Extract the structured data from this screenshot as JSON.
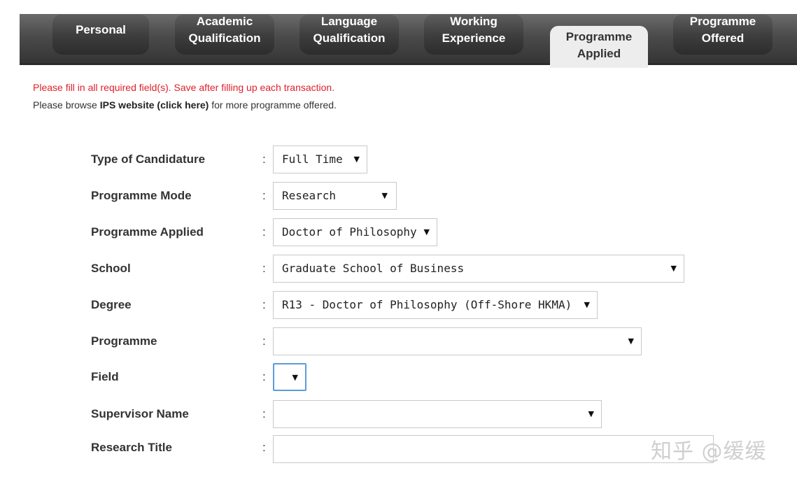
{
  "tabs": [
    {
      "label": "Personal"
    },
    {
      "label": "Academic\nQualification"
    },
    {
      "label": "Language\nQualification"
    },
    {
      "label": "Working\nExperience"
    },
    {
      "label": "Programme\nApplied",
      "active": true
    },
    {
      "label": "Programme\nOffered"
    }
  ],
  "messages": {
    "required": "Please fill in all required field(s). Save after filling up each transaction.",
    "browse_prefix": "Please browse ",
    "browse_link": "IPS website (click here)",
    "browse_suffix": " for more programme offered."
  },
  "form": {
    "colon": ":",
    "candidature": {
      "label": "Type of Candidature",
      "value": "Full Time"
    },
    "mode": {
      "label": "Programme Mode",
      "value": "Research"
    },
    "applied": {
      "label": "Programme Applied",
      "value": "Doctor of Philosophy"
    },
    "school": {
      "label": "School",
      "value": "Graduate School of Business"
    },
    "degree": {
      "label": "Degree",
      "value": "R13 - Doctor of Philosophy (Off-Shore HKMA)"
    },
    "programme": {
      "label": "Programme",
      "value": ""
    },
    "field": {
      "label": "Field",
      "value": ""
    },
    "supervisor": {
      "label": "Supervisor Name",
      "value": ""
    },
    "research_title": {
      "label": "Research Title",
      "value": ""
    }
  },
  "icons": {
    "dropdown": "▼"
  },
  "watermark": "知乎 @缓缓",
  "colors": {
    "error": "#e0202b",
    "focus": "#5d9bd6",
    "tab_dark": "#333333",
    "tab_active": "#ededed"
  }
}
